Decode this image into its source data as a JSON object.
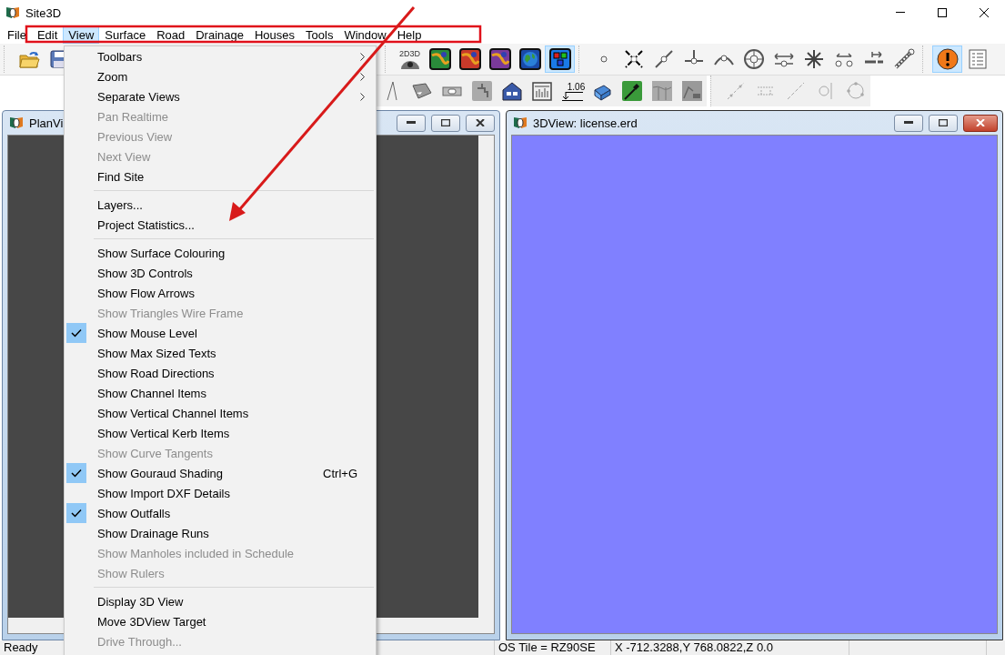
{
  "window": {
    "title": "Site3D"
  },
  "menu_bar": [
    {
      "label": "File",
      "selected": false
    },
    {
      "label": "Edit",
      "selected": false
    },
    {
      "label": "View",
      "selected": true
    },
    {
      "label": "Surface",
      "selected": false
    },
    {
      "label": "Road",
      "selected": false
    },
    {
      "label": "Drainage",
      "selected": false
    },
    {
      "label": "Houses",
      "selected": false
    },
    {
      "label": "Tools",
      "selected": false
    },
    {
      "label": "Window",
      "selected": false
    },
    {
      "label": "Help",
      "selected": false
    }
  ],
  "toolbars": [
    {
      "groups": [
        [
          {
            "kind": "open",
            "selected": false
          },
          {
            "kind": "save",
            "selected": false
          }
        ],
        [
          {
            "kind": "d23",
            "label": "2D3D",
            "selected": false
          },
          {
            "kind": "map",
            "color": "#2a8a3a",
            "selected": false
          },
          {
            "kind": "map",
            "color": "#c83a2a",
            "selected": false
          },
          {
            "kind": "map",
            "color": "#7a3a9a",
            "selected": false
          },
          {
            "kind": "globe",
            "selected": false
          },
          {
            "kind": "blocks",
            "selected": true
          }
        ],
        [
          {
            "kind": "point",
            "selected": false
          },
          {
            "kind": "cross",
            "selected": false
          },
          {
            "kind": "diag",
            "selected": false
          },
          {
            "kind": "tee",
            "selected": false
          },
          {
            "kind": "arc",
            "selected": false
          },
          {
            "kind": "target",
            "selected": false
          },
          {
            "kind": "hmove",
            "selected": false
          },
          {
            "kind": "star",
            "selected": false
          },
          {
            "kind": "split",
            "selected": false
          },
          {
            "kind": "extend",
            "selected": false
          },
          {
            "kind": "wrench",
            "selected": false
          }
        ],
        [
          {
            "kind": "warning",
            "selected": true
          },
          {
            "kind": "list",
            "selected": false
          }
        ]
      ]
    },
    {
      "groups": [
        [
          {
            "kind": "tri",
            "selected": false
          },
          {
            "kind": "beam",
            "selected": false
          },
          {
            "kind": "pipe",
            "selected": false
          },
          {
            "kind": "tap",
            "selected": false
          },
          {
            "kind": "house",
            "selected": false
          },
          {
            "kind": "chart",
            "selected": false
          },
          {
            "kind": "level",
            "label": "1.06",
            "selected": false
          },
          {
            "kind": "toolbox",
            "selected": false
          },
          {
            "kind": "shovel",
            "selected": false
          },
          {
            "kind": "section",
            "selected": false
          },
          {
            "kind": "excavator",
            "selected": false
          }
        ],
        [
          {
            "kind": "dashline",
            "selected": false
          },
          {
            "kind": "dim",
            "selected": false
          },
          {
            "kind": "dashdiag",
            "selected": false
          },
          {
            "kind": "circleline",
            "selected": false
          },
          {
            "kind": "circledots",
            "selected": false
          }
        ]
      ]
    }
  ],
  "windows": [
    {
      "kind": "plan",
      "title": "PlanVi",
      "active": false
    },
    {
      "kind": "view3d",
      "title": "3DView: license.erd",
      "active": true
    }
  ],
  "view_menu": [
    {
      "kind": "item",
      "label": "Toolbars",
      "disabled": false,
      "checked": false,
      "submenu": true
    },
    {
      "kind": "item",
      "label": "Zoom",
      "disabled": false,
      "checked": false,
      "submenu": true
    },
    {
      "kind": "item",
      "label": "Separate Views",
      "disabled": false,
      "checked": false,
      "submenu": true
    },
    {
      "kind": "item",
      "label": "Pan Realtime",
      "disabled": true,
      "checked": false,
      "submenu": false
    },
    {
      "kind": "item",
      "label": "Previous View",
      "disabled": true,
      "checked": false,
      "submenu": false
    },
    {
      "kind": "item",
      "label": "Next View",
      "disabled": true,
      "checked": false,
      "submenu": false
    },
    {
      "kind": "item",
      "label": "Find Site",
      "disabled": false,
      "checked": false,
      "submenu": false
    },
    {
      "kind": "separator"
    },
    {
      "kind": "item",
      "label": "Layers...",
      "disabled": false,
      "checked": false,
      "submenu": false
    },
    {
      "kind": "item",
      "label": "Project Statistics...",
      "disabled": false,
      "checked": false,
      "submenu": false
    },
    {
      "kind": "separator"
    },
    {
      "kind": "item",
      "label": "Show Surface Colouring",
      "disabled": false,
      "checked": false,
      "submenu": false
    },
    {
      "kind": "item",
      "label": "Show 3D Controls",
      "disabled": false,
      "checked": false,
      "submenu": false
    },
    {
      "kind": "item",
      "label": "Show Flow Arrows",
      "disabled": false,
      "checked": false,
      "submenu": false
    },
    {
      "kind": "item",
      "label": "Show Triangles Wire Frame",
      "disabled": true,
      "checked": false,
      "submenu": false
    },
    {
      "kind": "item",
      "label": "Show Mouse Level",
      "disabled": false,
      "checked": true,
      "submenu": false
    },
    {
      "kind": "item",
      "label": "Show Max Sized Texts",
      "disabled": false,
      "checked": false,
      "submenu": false
    },
    {
      "kind": "item",
      "label": "Show Road Directions",
      "disabled": false,
      "checked": false,
      "submenu": false
    },
    {
      "kind": "item",
      "label": "Show Channel Items",
      "disabled": false,
      "checked": false,
      "submenu": false
    },
    {
      "kind": "item",
      "label": "Show Vertical Channel Items",
      "disabled": false,
      "checked": false,
      "submenu": false
    },
    {
      "kind": "item",
      "label": "Show Vertical Kerb Items",
      "disabled": false,
      "checked": false,
      "submenu": false
    },
    {
      "kind": "item",
      "label": "Show Curve Tangents",
      "disabled": true,
      "checked": false,
      "submenu": false
    },
    {
      "kind": "item",
      "label": "Show Gouraud Shading",
      "disabled": false,
      "checked": true,
      "submenu": false,
      "shortcut": "Ctrl+G"
    },
    {
      "kind": "item",
      "label": "Show Import DXF Details",
      "disabled": false,
      "checked": false,
      "submenu": false
    },
    {
      "kind": "item",
      "label": "Show Outfalls",
      "disabled": false,
      "checked": true,
      "submenu": false
    },
    {
      "kind": "item",
      "label": "Show Drainage Runs",
      "disabled": false,
      "checked": false,
      "submenu": false
    },
    {
      "kind": "item",
      "label": "Show Manholes included in Schedule",
      "disabled": true,
      "checked": false,
      "submenu": false
    },
    {
      "kind": "item",
      "label": "Show Rulers",
      "disabled": true,
      "checked": false,
      "submenu": false
    },
    {
      "kind": "separator"
    },
    {
      "kind": "item",
      "label": "Display 3D View",
      "disabled": false,
      "checked": false,
      "submenu": false
    },
    {
      "kind": "item",
      "label": "Move 3DView Target",
      "disabled": false,
      "checked": false,
      "submenu": false
    },
    {
      "kind": "item",
      "label": "Drive Through...",
      "disabled": true,
      "checked": false,
      "submenu": false
    }
  ],
  "status_bar": [
    "Ready",
    "OS Tile = RZ90SE",
    "X -712.3288,Y 768.0822,Z 0.0"
  ]
}
